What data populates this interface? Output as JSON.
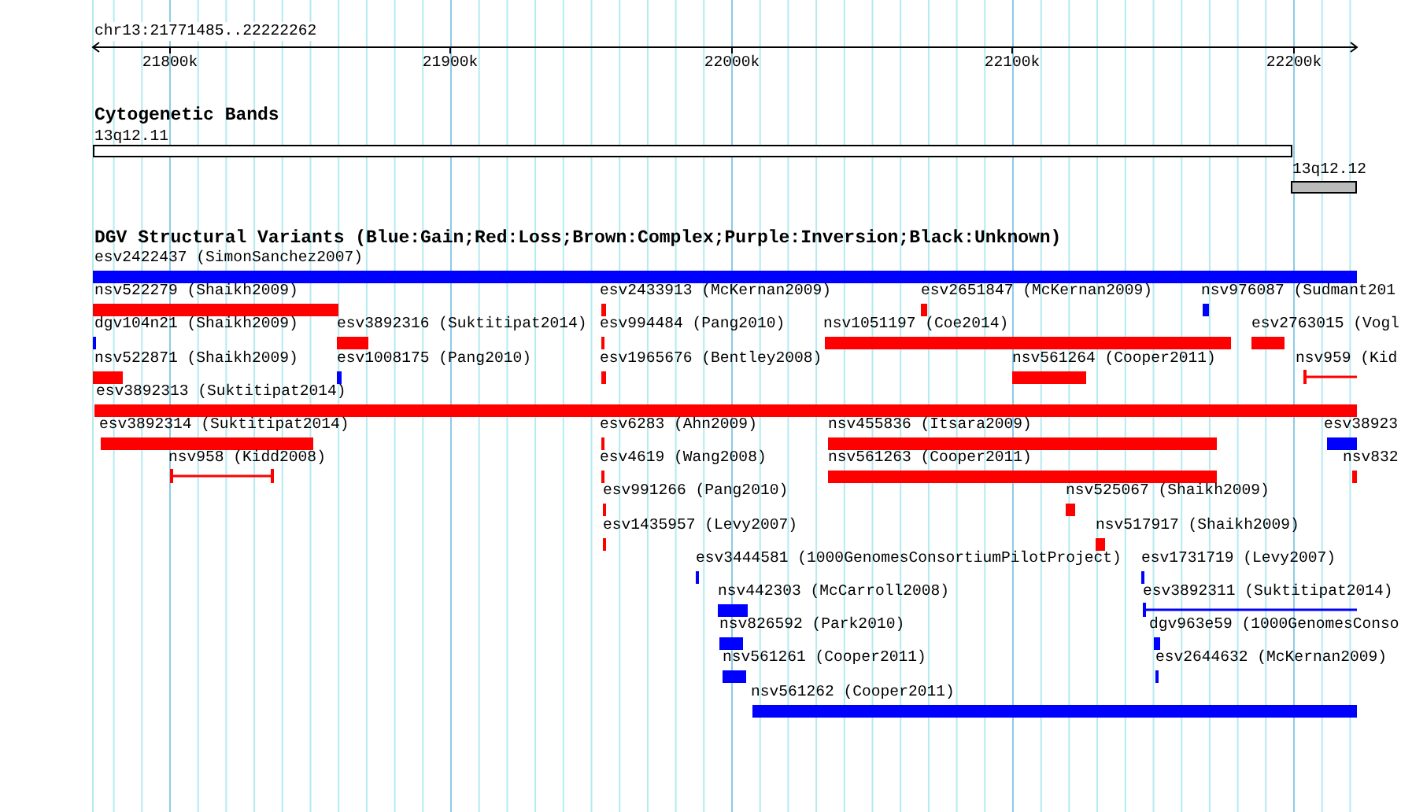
{
  "location": "chr13:21771485..22222262",
  "ruler": {
    "ticks": [
      "21800k",
      "21900k",
      "22000k",
      "22100k",
      "22200k"
    ]
  },
  "cytoband_track": {
    "title": "Cytogenetic Bands",
    "bands": [
      {
        "label": "13q12.11",
        "kind": "unstained"
      },
      {
        "label": "13q12.12",
        "kind": "stained"
      }
    ]
  },
  "variant_track": {
    "title": "DGV Structural Variants (Blue:Gain;Red:Loss;Brown:Complex;Purple:Inversion;Black:Unknown)",
    "rows": [
      {
        "features": [
          {
            "label": "esv2422437 (SimonSanchez2007)",
            "color": "#0000ff",
            "kind": "bar"
          }
        ]
      },
      {
        "features": [
          {
            "label": "nsv522279 (Shaikh2009)",
            "color": "#ff0000",
            "kind": "bar"
          },
          {
            "label": "esv2433913 (McKernan2009)",
            "color": "#ff0000",
            "kind": "bar"
          },
          {
            "label": "esv2651847 (McKernan2009)",
            "color": "#ff0000",
            "kind": "bar"
          },
          {
            "label": "nsv976087 (Sudmant201",
            "color": "#0000ff",
            "kind": "bar"
          }
        ]
      },
      {
        "features": [
          {
            "label": "dgv104n21 (Shaikh2009)",
            "color": "#0000ff",
            "kind": "bar"
          },
          {
            "label": "esv3892316 (Suktitipat2014)",
            "color": "#ff0000",
            "kind": "bar"
          },
          {
            "label": "esv994484 (Pang2010)",
            "color": "#ff0000",
            "kind": "bar"
          },
          {
            "label": "nsv1051197 (Coe2014)",
            "color": "#ff0000",
            "kind": "bar"
          },
          {
            "label": "esv2763015 (Vogl",
            "color": "#ff0000",
            "kind": "bar"
          }
        ]
      },
      {
        "features": [
          {
            "label": "nsv522871 (Shaikh2009)",
            "color": "#ff0000",
            "kind": "bar"
          },
          {
            "label": "esv1008175 (Pang2010)",
            "color": "#0000ff",
            "kind": "bar"
          },
          {
            "label": "esv1965676 (Bentley2008)",
            "color": "#ff0000",
            "kind": "bar"
          },
          {
            "label": "nsv561264 (Cooper2011)",
            "color": "#ff0000",
            "kind": "bar"
          },
          {
            "label": "nsv959 (Kid",
            "color": "#ff0000",
            "kind": "span"
          }
        ]
      },
      {
        "features": [
          {
            "label": "esv3892313 (Suktitipat2014)",
            "color": "#ff0000",
            "kind": "bar"
          }
        ]
      },
      {
        "features": [
          {
            "label": "esv3892314 (Suktitipat2014)",
            "color": "#ff0000",
            "kind": "bar"
          },
          {
            "label": "esv6283 (Ahn2009)",
            "color": "#ff0000",
            "kind": "bar"
          },
          {
            "label": "nsv455836 (Itsara2009)",
            "color": "#ff0000",
            "kind": "bar"
          },
          {
            "label": "esv38923",
            "color": "#0000ff",
            "kind": "bar"
          }
        ]
      },
      {
        "features": [
          {
            "label": "nsv958 (Kidd2008)",
            "color": "#ff0000",
            "kind": "span"
          },
          {
            "label": "esv4619 (Wang2008)",
            "color": "#ff0000",
            "kind": "bar"
          },
          {
            "label": "nsv561263 (Cooper2011)",
            "color": "#ff0000",
            "kind": "bar"
          },
          {
            "label": "nsv832",
            "color": "#ff0000",
            "kind": "bar"
          }
        ]
      },
      {
        "features": [
          {
            "label": "esv991266 (Pang2010)",
            "color": "#ff0000",
            "kind": "bar"
          },
          {
            "label": "nsv525067 (Shaikh2009)",
            "color": "#ff0000",
            "kind": "bar"
          }
        ]
      },
      {
        "features": [
          {
            "label": "esv1435957 (Levy2007)",
            "color": "#ff0000",
            "kind": "bar"
          },
          {
            "label": "nsv517917 (Shaikh2009)",
            "color": "#ff0000",
            "kind": "bar"
          }
        ]
      },
      {
        "features": [
          {
            "label": "esv3444581 (1000GenomesConsortiumPilotProject)",
            "color": "#0000ff",
            "kind": "bar"
          },
          {
            "label": "esv1731719 (Levy2007)",
            "color": "#0000ff",
            "kind": "bar"
          }
        ]
      },
      {
        "features": [
          {
            "label": "nsv442303 (McCarroll2008)",
            "color": "#0000ff",
            "kind": "bar"
          },
          {
            "label": "esv3892311 (Suktitipat2014)",
            "color": "#0000ff",
            "kind": "span"
          }
        ]
      },
      {
        "features": [
          {
            "label": "nsv826592 (Park2010)",
            "color": "#0000ff",
            "kind": "bar"
          },
          {
            "label": "dgv963e59 (1000GenomesConso",
            "color": "#0000ff",
            "kind": "bar"
          }
        ]
      },
      {
        "features": [
          {
            "label": "nsv561261 (Cooper2011)",
            "color": "#0000ff",
            "kind": "bar"
          },
          {
            "label": "esv2644632 (McKernan2009)",
            "color": "#0000ff",
            "kind": "bar"
          }
        ]
      },
      {
        "features": [
          {
            "label": "nsv561262 (Cooper2011)",
            "color": "#0000ff",
            "kind": "bar"
          }
        ]
      }
    ]
  }
}
